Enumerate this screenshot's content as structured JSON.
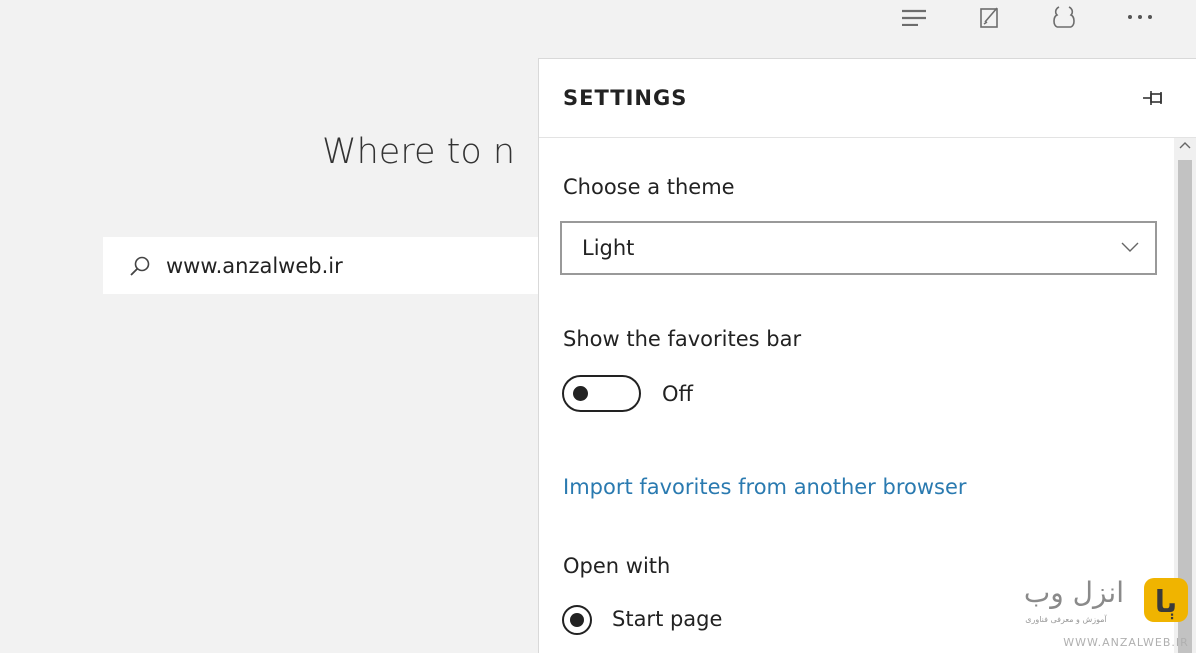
{
  "toolbar": {
    "icons": [
      "hub-icon",
      "web-note-icon",
      "share-icon",
      "more-icon"
    ]
  },
  "newtab": {
    "heading": "Where to n",
    "search": {
      "value": "www.anzalweb.ir"
    }
  },
  "settings": {
    "title": "SETTINGS",
    "theme": {
      "label": "Choose a theme",
      "value": "Light"
    },
    "favorites_bar": {
      "label": "Show the favorites bar",
      "state": "Off"
    },
    "import_link": "Import favorites from another browser",
    "open_with": {
      "label": "Open with",
      "option": "Start page"
    }
  },
  "watermark": {
    "brand": "انزل وب",
    "tagline": "آموزش و معرفی فناوری",
    "url": "WWW.ANZALWEB.IR"
  },
  "colors": {
    "link": "#2a7ab0",
    "page_background": "#f2f2f2",
    "panel_background": "#ffffff",
    "watermark_accent": "#f0b400"
  }
}
